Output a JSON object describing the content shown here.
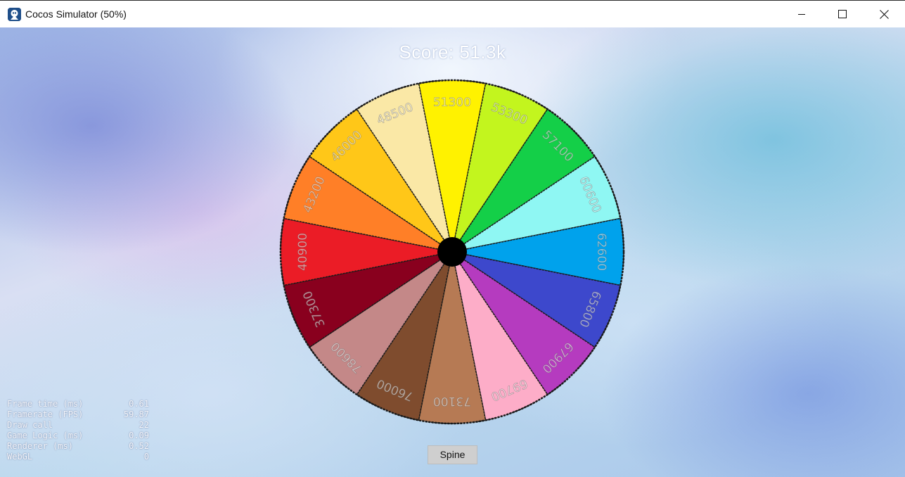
{
  "window": {
    "title": "Cocos Simulator (50%)",
    "icon": "cocos-app-icon",
    "controls": [
      "minimize-icon",
      "maximize-icon",
      "close-icon"
    ]
  },
  "game": {
    "score_text": "Score: 51.3k",
    "spine_button_label": "Spine",
    "wheel": {
      "segments": [
        {
          "label": "51300",
          "color": "#fff200"
        },
        {
          "label": "53300",
          "color": "#c3f51e"
        },
        {
          "label": "57100",
          "color": "#14cf48"
        },
        {
          "label": "60600",
          "color": "#8ff7f3"
        },
        {
          "label": "62600",
          "color": "#00a2ec"
        },
        {
          "label": "65800",
          "color": "#3d48cc"
        },
        {
          "label": "67900",
          "color": "#b53bbf"
        },
        {
          "label": "69700",
          "color": "#fdadc8"
        },
        {
          "label": "73100",
          "color": "#b67a54"
        },
        {
          "label": "76000",
          "color": "#7f4c2e"
        },
        {
          "label": "78600",
          "color": "#c48888"
        },
        {
          "label": "37300",
          "color": "#89001e"
        },
        {
          "label": "40900",
          "color": "#eb1c26"
        },
        {
          "label": "43200",
          "color": "#ff7f27"
        },
        {
          "label": "46000",
          "color": "#ffc718"
        },
        {
          "label": "48500",
          "color": "#fae8a6"
        }
      ],
      "hub_color": "#000000"
    }
  },
  "stats": [
    {
      "label": "Frame time (ms)",
      "value": "0.61"
    },
    {
      "label": "Framerate (FPS)",
      "value": "59.87"
    },
    {
      "label": "Draw call",
      "value": "22"
    },
    {
      "label": "Game Logic (ms)",
      "value": "0.09"
    },
    {
      "label": "Renderer (ms)",
      "value": "0.52"
    },
    {
      "label": "WebGL",
      "value": "0"
    }
  ]
}
